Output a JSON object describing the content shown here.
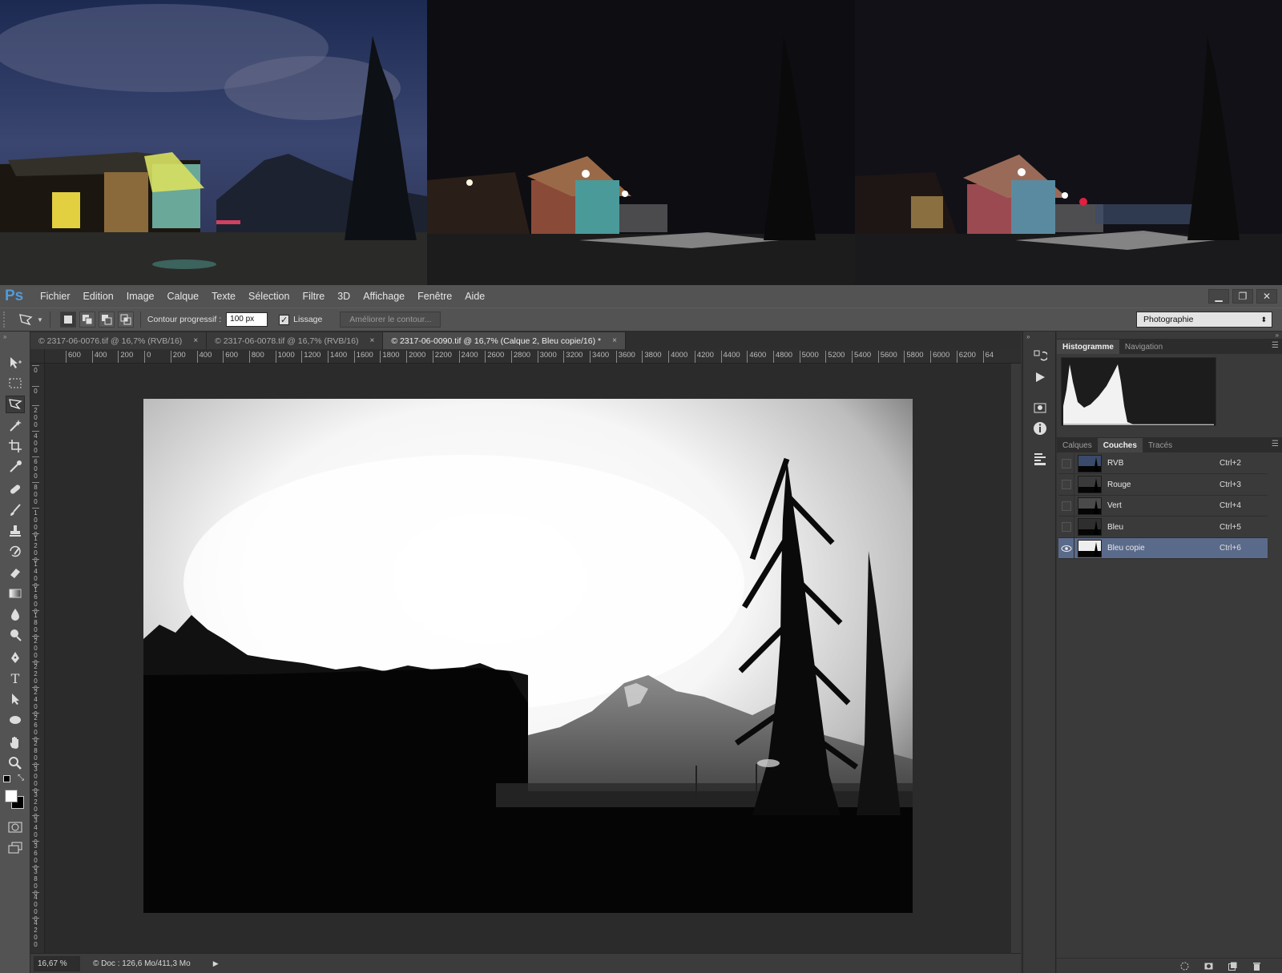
{
  "app": {
    "logo": "Ps"
  },
  "menu": [
    "Fichier",
    "Edition",
    "Image",
    "Calque",
    "Texte",
    "Sélection",
    "Filtre",
    "3D",
    "Affichage",
    "Fenêtre",
    "Aide"
  ],
  "window_controls": {
    "minimize": "▁",
    "restore": "❐",
    "close": "✕"
  },
  "options_bar": {
    "feather_label": "Contour progressif :",
    "feather_value": "100 px",
    "antialias_label": "Lissage",
    "antialias_checked": true,
    "refine_edge_label": "Améliorer le contour...",
    "workspace": "Photographie"
  },
  "tabs": [
    {
      "label": "© 2317-06-0076.tif @ 16,7% (RVB/16)",
      "active": false
    },
    {
      "label": "© 2317-06-0078.tif @ 16,7% (RVB/16)",
      "active": false
    },
    {
      "label": "© 2317-06-0090.tif @ 16,7% (Calque 2, Bleu copie/16) *",
      "active": true
    }
  ],
  "ruler_h": [
    "600",
    "400",
    "200",
    "0",
    "200",
    "400",
    "600",
    "800",
    "1000",
    "1200",
    "1400",
    "1600",
    "1800",
    "2000",
    "2200",
    "2400",
    "2600",
    "2800",
    "3000",
    "3200",
    "3400",
    "3600",
    "3800",
    "4000",
    "4200",
    "4400",
    "4600",
    "4800",
    "5000",
    "5200",
    "5400",
    "5600",
    "5800",
    "6000",
    "6200",
    "64"
  ],
  "ruler_v": [
    "0",
    "0",
    "2\n0\n0",
    "4\n0\n0",
    "6\n0\n0",
    "8\n0\n0",
    "1\n0\n0\n0",
    "1\n2\n0\n0",
    "1\n4\n0\n0",
    "1\n6\n0\n0",
    "1\n8\n0\n0",
    "2\n0\n0\n0",
    "2\n2\n0\n0",
    "2\n4\n0\n0",
    "2\n6\n0\n0",
    "2\n8\n0\n0",
    "3\n0\n0\n0",
    "3\n2\n0\n0",
    "3\n4\n0\n0",
    "3\n6\n0\n0",
    "3\n8\n0\n0",
    "4\n0\n0\n0",
    "4\n2\n0\n0"
  ],
  "status": {
    "zoom": "16,67 %",
    "doc": "© Doc : 126,6 Mo/411,3 Mo",
    "arrow": "▶"
  },
  "panels": {
    "top_tabs": [
      "Histogramme",
      "Navigation"
    ],
    "bottom_tabs": [
      "Calques",
      "Couches",
      "Tracés"
    ],
    "menu_icon": "☰"
  },
  "channels": [
    {
      "name": "RVB",
      "shortcut": "Ctrl+2",
      "visible": false,
      "selected": false
    },
    {
      "name": "Rouge",
      "shortcut": "Ctrl+3",
      "visible": false,
      "selected": false
    },
    {
      "name": "Vert",
      "shortcut": "Ctrl+4",
      "visible": false,
      "selected": false
    },
    {
      "name": "Bleu",
      "shortcut": "Ctrl+5",
      "visible": false,
      "selected": false
    },
    {
      "name": "Bleu copie",
      "shortcut": "Ctrl+6",
      "visible": true,
      "selected": true
    }
  ],
  "colors": {
    "accent": "#4f9bd9",
    "selected_row": "#5a6a8a"
  }
}
